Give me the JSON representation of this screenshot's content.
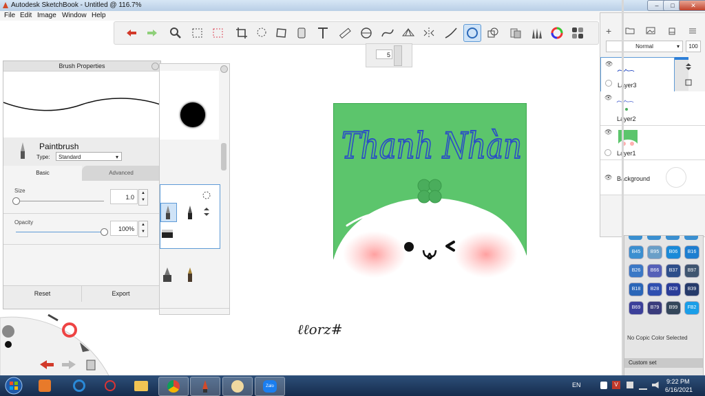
{
  "window": {
    "title": "Autodesk SketchBook - Untitled @ 116.7%",
    "min_label": "–",
    "max_label": "□",
    "close_label": "✕"
  },
  "menubar": [
    "File",
    "Edit",
    "Image",
    "Window",
    "Help"
  ],
  "toolbar": {
    "icons": [
      "undo-icon",
      "redo-icon",
      "zoom-icon",
      "select-rect-icon",
      "transform-icon",
      "crop-icon",
      "lasso-icon",
      "distort-icon",
      "fill-icon",
      "text-icon",
      "ruler-icon",
      "ellipse-guide-icon",
      "curve-guide-icon",
      "perspective-icon",
      "symmetry-icon",
      "stroke-icon",
      "circle-icon",
      "shape-icon",
      "copic-library-icon",
      "brush-library-icon",
      "color-wheel-icon",
      "palette-icon"
    ],
    "active_icon": "circle-icon",
    "size_value": "5"
  },
  "brush_properties": {
    "title": "Brush Properties",
    "brush_name": "Paintbrush",
    "type_label": "Type:",
    "type_value": "Standard",
    "tabs": [
      "Basic",
      "Advanced"
    ],
    "size_label": "Size",
    "size_value": "1.0",
    "size_fraction": 0.0,
    "opacity_label": "Opacity",
    "opacity_value": "100%",
    "opacity_fraction": 1.0,
    "reset_label": "Reset",
    "export_label": "Export"
  },
  "artwork": {
    "title_text": "Thanh Nhàn",
    "signature_text": "ℓℓorz#",
    "bg_color": "#5cc56c",
    "title_color": "#2b4fc4"
  },
  "layers": {
    "blend_mode": "Normal",
    "opacity": "100",
    "items": [
      {
        "name": "Layer3",
        "selected": true
      },
      {
        "name": "Layer2",
        "selected": false
      },
      {
        "name": "Layer1",
        "selected": false
      },
      {
        "name": "Background",
        "selected": false
      }
    ]
  },
  "copic": {
    "swatches": [
      {
        "code": "B45",
        "color": "#3b8fd0"
      },
      {
        "code": "B95",
        "color": "#6a9fc8"
      },
      {
        "code": "B06",
        "color": "#1a8ad8"
      },
      {
        "code": "B16",
        "color": "#1e7ed0"
      },
      {
        "code": "B26",
        "color": "#3a78c6"
      },
      {
        "code": "B66",
        "color": "#5560b8"
      },
      {
        "code": "B37",
        "color": "#2d4e8a"
      },
      {
        "code": "B97",
        "color": "#3f5570"
      },
      {
        "code": "B18",
        "color": "#2a66b8"
      },
      {
        "code": "B28",
        "color": "#2f4fb0"
      },
      {
        "code": "B29",
        "color": "#2a3d99"
      },
      {
        "code": "B39",
        "color": "#253a6a"
      },
      {
        "code": "B69",
        "color": "#3b3f9a"
      },
      {
        "code": "B79",
        "color": "#3a3c7c"
      },
      {
        "code": "B99",
        "color": "#34465a"
      },
      {
        "code": "FB2",
        "color": "#1a9ee8"
      }
    ],
    "status": "No Copic Color Selected",
    "set_label": "Custom set"
  },
  "taskbar": {
    "apps": [
      "media-player-icon",
      "internet-explorer-icon",
      "snipping-tool-icon",
      "file-explorer-icon",
      "chrome-icon",
      "sketchbook-icon",
      "paint-icon",
      "zalo-icon"
    ],
    "zalo_label": "Zalo",
    "lang": "EN",
    "time": "9:22 PM",
    "date": "6/16/2021"
  }
}
